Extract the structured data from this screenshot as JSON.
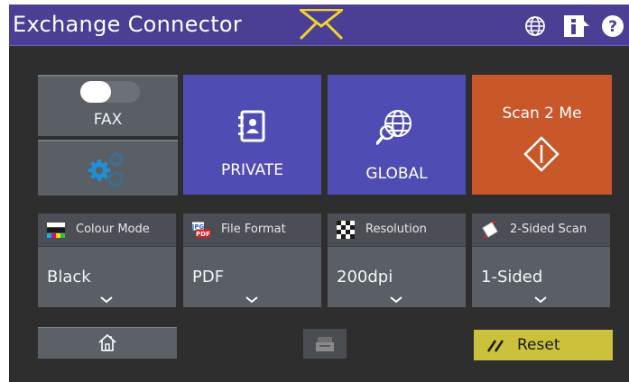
{
  "header": {
    "title": "Exchange Connector",
    "icons": [
      "mail-icon",
      "globe-icon",
      "info-icon",
      "help-icon"
    ]
  },
  "tiles": {
    "fax": {
      "label": "FAX",
      "toggle_on": false
    },
    "settings": {
      "icon": "gears-icon"
    },
    "private": {
      "label": "PRIVATE",
      "icon": "address-book-icon"
    },
    "global": {
      "label": "GLOBAL",
      "icon": "globe-search-icon"
    },
    "scan_to_me": {
      "label": "Scan 2 Me",
      "icon": "start-diamond-icon"
    }
  },
  "settings": [
    {
      "label": "Colour Mode",
      "value": "Black",
      "icon": "colour-mode-icon"
    },
    {
      "label": "File Format",
      "value": "PDF",
      "icon": "file-format-icon",
      "icon_text": [
        "JPG",
        "PDF"
      ]
    },
    {
      "label": "Resolution",
      "value": "200dpi",
      "icon": "resolution-icon"
    },
    {
      "label": "2-Sided Scan",
      "value": "1-Sided",
      "icon": "duplex-icon"
    }
  ],
  "footer": {
    "home_icon": "home-icon",
    "scanner_icon": "scanner-icon",
    "reset_label": "Reset"
  },
  "colors": {
    "titlebar": "#4a3f94",
    "background": "#2e2e2e",
    "tile_blue": "#4f4db3",
    "tile_orange": "#c8572a",
    "tile_grey": "#5a5f66",
    "reset_yellow": "#ccc13a",
    "mail_yellow": "#f2d230"
  }
}
